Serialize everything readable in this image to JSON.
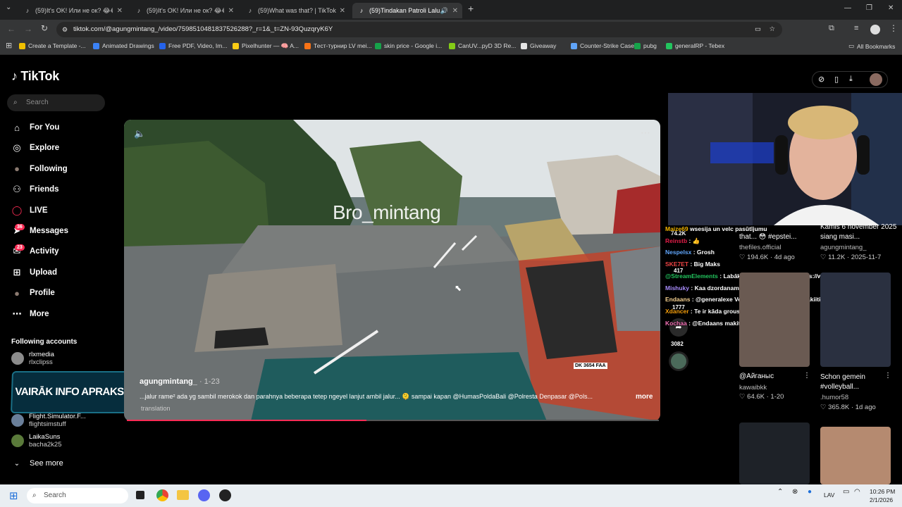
{
  "browser": {
    "tabs": [
      {
        "title": "(59)It's OK! Или не ок? 😂😂 #..."
      },
      {
        "title": "(59)It's OK! Или не ок? 😂😂 #..."
      },
      {
        "title": "(59)What was that? | TikTok"
      },
      {
        "title": "(59)Tindakan Patroli Lalu Lin..."
      }
    ],
    "new_tab": "+",
    "url": "tiktok.com/@agungmintang_/video/7598510481837526288?_r=1&_t=ZN-93QuzqryK6Y",
    "bookmarks": [
      {
        "label": "Create a Template -...",
        "color": "#f0c000"
      },
      {
        "label": "Animated Drawings",
        "color": "#3b82f6"
      },
      {
        "label": "Free PDF, Video, Im...",
        "color": "#2563eb"
      },
      {
        "label": "Pixelhunter — 🧠 A...",
        "color": "#facc15"
      },
      {
        "label": "Тест-турнир LV mei...",
        "color": "#f97316"
      },
      {
        "label": "skin price - Google i...",
        "color": "#16a34a"
      },
      {
        "label": "CanUV...pyD 3D Re...",
        "color": "#84cc16"
      },
      {
        "label": "Giveaway",
        "color": "#e5e5e5"
      },
      {
        "label": "Counter-Strike Case...",
        "color": "#60a5fa"
      },
      {
        "label": "pubg",
        "color": "#16a34a"
      },
      {
        "label": "generalRP - Tebex",
        "color": "#22c55e"
      }
    ],
    "all_bookmarks": "All Bookmarks"
  },
  "tiktok": {
    "logo": "TikTok",
    "search_placeholder": "Search",
    "nav": [
      {
        "label": "For You",
        "icon": "home-icon"
      },
      {
        "label": "Explore",
        "icon": "compass-icon"
      },
      {
        "label": "Following",
        "icon": "avatar-icon"
      },
      {
        "label": "Friends",
        "icon": "users-icon"
      },
      {
        "label": "LIVE",
        "icon": "live-icon"
      },
      {
        "label": "Messages",
        "icon": "send-icon",
        "badge": "36"
      },
      {
        "label": "Activity",
        "icon": "inbox-icon",
        "badge": "23"
      },
      {
        "label": "Upload",
        "icon": "plus-square-icon"
      },
      {
        "label": "Profile",
        "icon": "avatar-icon"
      },
      {
        "label": "More",
        "icon": "dots-icon"
      }
    ],
    "following_title": "Following accounts",
    "accounts": [
      {
        "name": "rlxmedia",
        "handle": "rlxclipss"
      },
      {
        "name": "Flight.Simulator.F...",
        "handle": "flightsimstuff"
      },
      {
        "name": "LaikaSuns",
        "handle": "bacha2k25"
      }
    ],
    "see_more": "See more",
    "promo": "VAIRĀK INFO APRAKSTĀ"
  },
  "video": {
    "watermark": "Bro_mintang",
    "author": "agungmintang_",
    "date": "1-23",
    "caption": "...jalur rame²  ada yg sambil merokok dan parahnya beberapa tetep ngeyel lanjut ambil jalur... 🫠 sampai kapan @HumasPoldaBali @Polresta Denpasar @Pols...",
    "more": "more",
    "translation": "translation",
    "plate": "DK 3654 FAA",
    "progress": 0.45
  },
  "actions": {
    "likes": "74.2K",
    "comments": "417",
    "saves": "1777",
    "shares": "3082"
  },
  "chat": [
    {
      "user": "Maize69",
      "color": "#f5b700",
      "msg": "wsesija un velc pasūtījumu"
    },
    {
      "user": "Reinstb",
      "color": "#e11d48",
      "msg": ": 👍"
    },
    {
      "user": "Nespelsx",
      "color": "#60a5fa",
      "msg": ": Grosh"
    },
    {
      "user": "SKE7ET",
      "color": "#ef4444",
      "msg": ": Big Maks"
    },
    {
      "user": "@StreamElements",
      "color": "#22c55e",
      "msg": ": Labākā vieta kur mācīties https://www.augstskola.lv/"
    },
    {
      "user": "Mishuky",
      "color": "#a78bfa",
      "msg": ": Kaa dzordanam iet?"
    },
    {
      "user": "Endaans",
      "color": "#f5d090",
      "msg": ": @generalexe Vel var paspeet nopirkt makiiti man liekas"
    },
    {
      "user": "Xdancer",
      "color": "#f59e0b",
      "msg": ": Te ir kāda grousa?"
    },
    {
      "user": "Kochaa",
      "color": "#f472b6",
      "msg": ": @Endaans makitis 24/7"
    }
  ],
  "cards": [
    {
      "title": "that... 😳 #epstei...",
      "user": "thefiles.official",
      "stats": "♡ 194.6K · 4d ago"
    },
    {
      "title": "Kamis 6 november 2025 siang masi...",
      "user": "agungmintang_",
      "stats": "♡ 11.2K · 2025-11-7"
    },
    {
      "title": "@Айганыс",
      "user": "kawaibkk",
      "stats": "♡ 64.6K · 1-20"
    },
    {
      "title": "Schon gemein #volleyball...",
      "user": ".humor58",
      "stats": "♡ 365.8K · 1d ago"
    }
  ],
  "taskbar": {
    "search": "Search",
    "lang": "LAV",
    "time": "10:26 PM",
    "date": "2/1/2026"
  },
  "colors": {
    "accent": "#fe2c55",
    "bg": "#000000"
  }
}
